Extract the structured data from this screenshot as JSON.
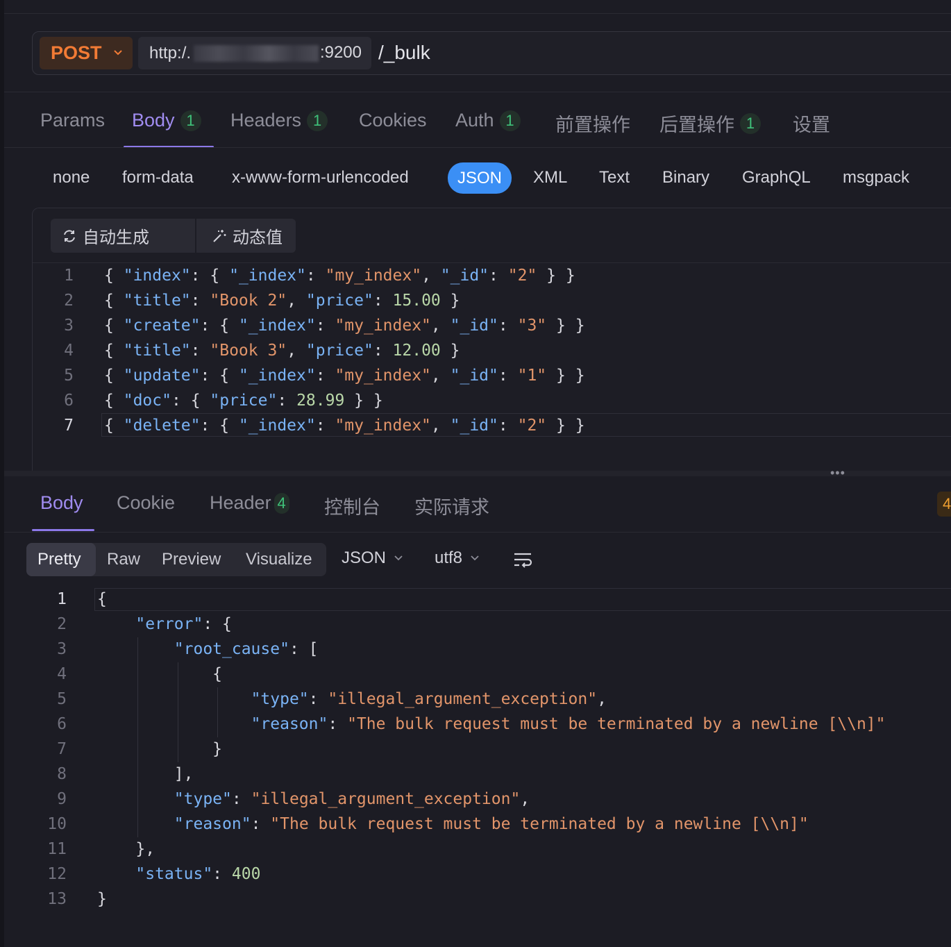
{
  "request": {
    "method": "POST",
    "base_url_prefix": "http:/.",
    "base_url_port": ":9200",
    "path": "/_bulk"
  },
  "request_tabs": [
    {
      "label": "Params",
      "badge": ""
    },
    {
      "label": "Body",
      "badge": "1"
    },
    {
      "label": "Headers",
      "badge": "1"
    },
    {
      "label": "Cookies",
      "badge": ""
    },
    {
      "label": "Auth",
      "badge": "1"
    },
    {
      "label": "前置操作",
      "badge": ""
    },
    {
      "label": "后置操作",
      "badge": "1"
    },
    {
      "label": "设置",
      "badge": ""
    }
  ],
  "active_request_tab": "Body",
  "body_types": [
    "none",
    "form-data",
    "x-www-form-urlencoded",
    "JSON",
    "XML",
    "Text",
    "Binary",
    "GraphQL",
    "msgpack"
  ],
  "active_body_type": "JSON",
  "editor_toolbar": {
    "auto_generate": "自动生成",
    "dynamic_value": "动态值"
  },
  "request_body_lines": [
    "{ \"index\": { \"_index\": \"my_index\", \"_id\": \"2\" } }",
    "{ \"title\": \"Book 2\", \"price\": 15.00 }",
    "{ \"create\": { \"_index\": \"my_index\", \"_id\": \"3\" } }",
    "{ \"title\": \"Book 3\", \"price\": 12.00 }",
    "{ \"update\": { \"_index\": \"my_index\", \"_id\": \"1\" } }",
    "{ \"doc\": { \"price\": 28.99 } }",
    "{ \"delete\": { \"_index\": \"my_index\", \"_id\": \"2\" } }"
  ],
  "response_tabs": [
    {
      "label": "Body",
      "badge": ""
    },
    {
      "label": "Cookie",
      "badge": ""
    },
    {
      "label": "Header",
      "badge": "4"
    },
    {
      "label": "控制台",
      "badge": ""
    },
    {
      "label": "实际请求",
      "badge": ""
    }
  ],
  "response_corner_badge": "4",
  "view_modes": [
    "Pretty",
    "Raw",
    "Preview",
    "Visualize"
  ],
  "active_view_mode": "Pretty",
  "response_format": "JSON",
  "response_encoding": "utf8",
  "wrap_icon": "wrap-lines-icon",
  "response_body_lines": [
    "{",
    "    \"error\": {",
    "        \"root_cause\": [",
    "            {",
    "                \"type\": \"illegal_argument_exception\",",
    "                \"reason\": \"The bulk request must be terminated by a newline [\\\\n]\"",
    "            }",
    "        ],",
    "        \"type\": \"illegal_argument_exception\",",
    "        \"reason\": \"The bulk request must be terminated by a newline [\\\\n]\"",
    "    },",
    "    \"status\": 400",
    "}"
  ],
  "colors": {
    "accent": "#8c78e8",
    "method": "#f27b35",
    "json_pill": "#3b8ff5",
    "badge_green": "#3fc27a",
    "key": "#7ab3f5",
    "string": "#e2956a",
    "number": "#b9d7a8"
  }
}
